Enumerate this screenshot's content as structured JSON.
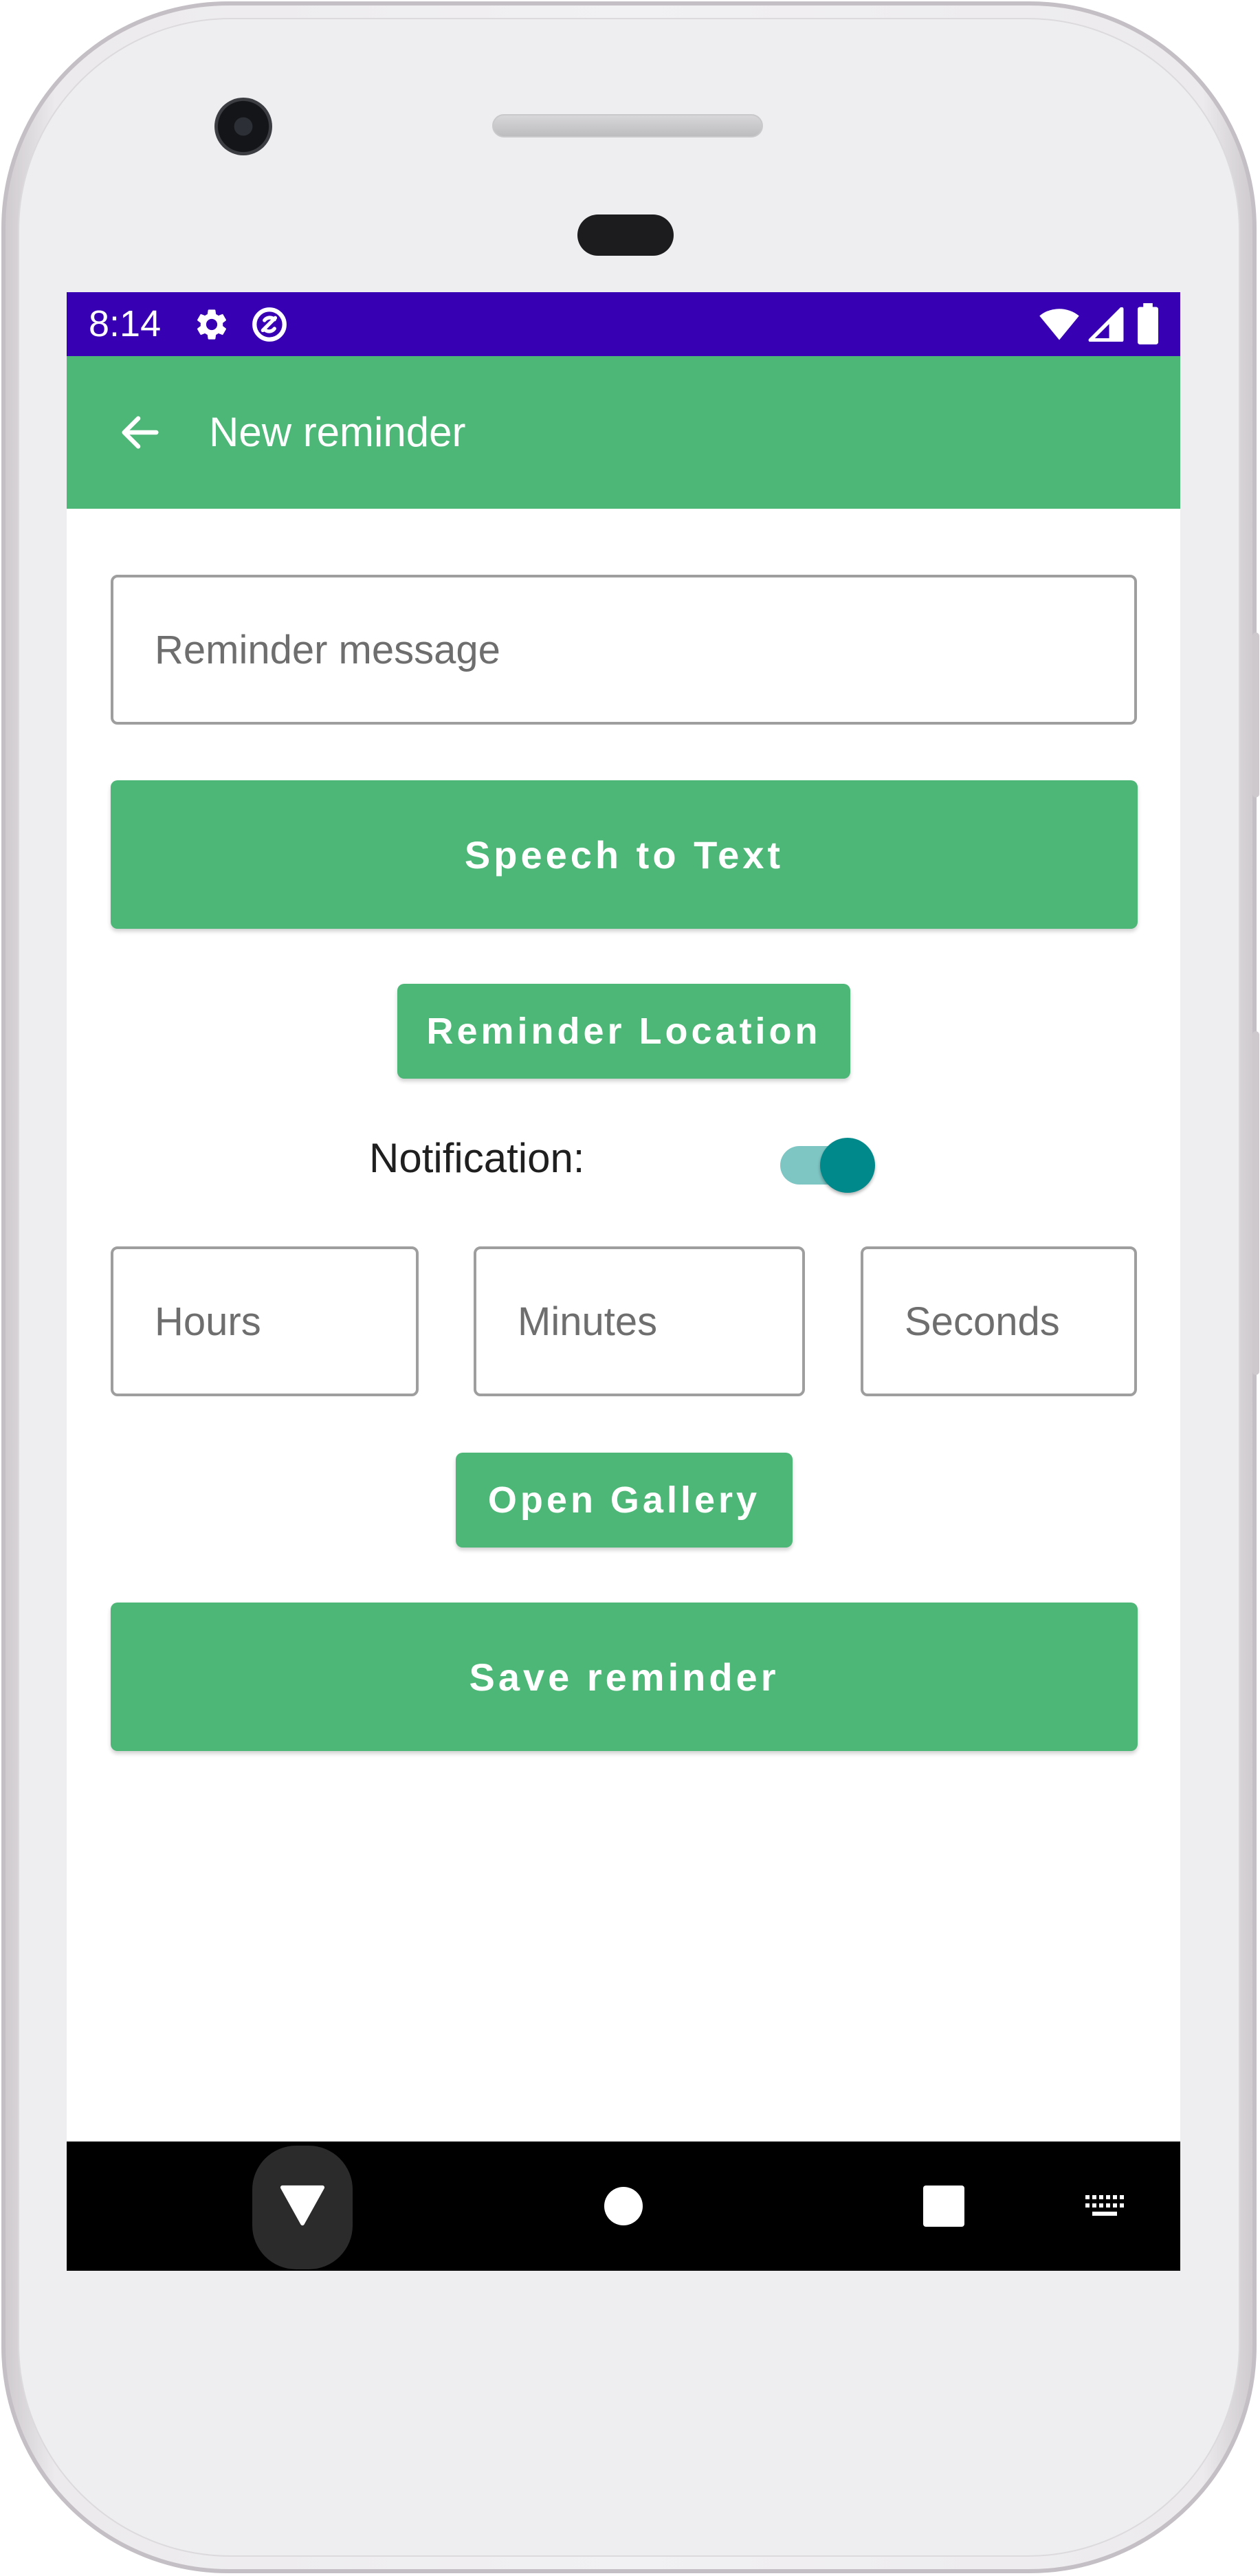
{
  "status_bar": {
    "time": "8:14",
    "left_icons": [
      "gear-icon",
      "sync-icon"
    ],
    "right_icons": [
      "wifi-icon",
      "signal-icon",
      "battery-icon"
    ],
    "color": "#3700b3"
  },
  "app_bar": {
    "title": "New reminder",
    "back_icon": "arrow-back-icon",
    "color": "#4cb777"
  },
  "form": {
    "message_placeholder": "Reminder message",
    "speech_button": "Speech to Text",
    "location_button": "Reminder Location",
    "notification_label": "Notification:",
    "notification_enabled": true,
    "hours_placeholder": "Hours",
    "minutes_placeholder": "Minutes",
    "seconds_placeholder": "Seconds",
    "gallery_button": "Open Gallery",
    "save_button": "Save reminder"
  },
  "nav_bar": {
    "icons": [
      "back-triangle-icon",
      "home-circle-icon",
      "recents-square-icon",
      "keyboard-icon"
    ]
  }
}
